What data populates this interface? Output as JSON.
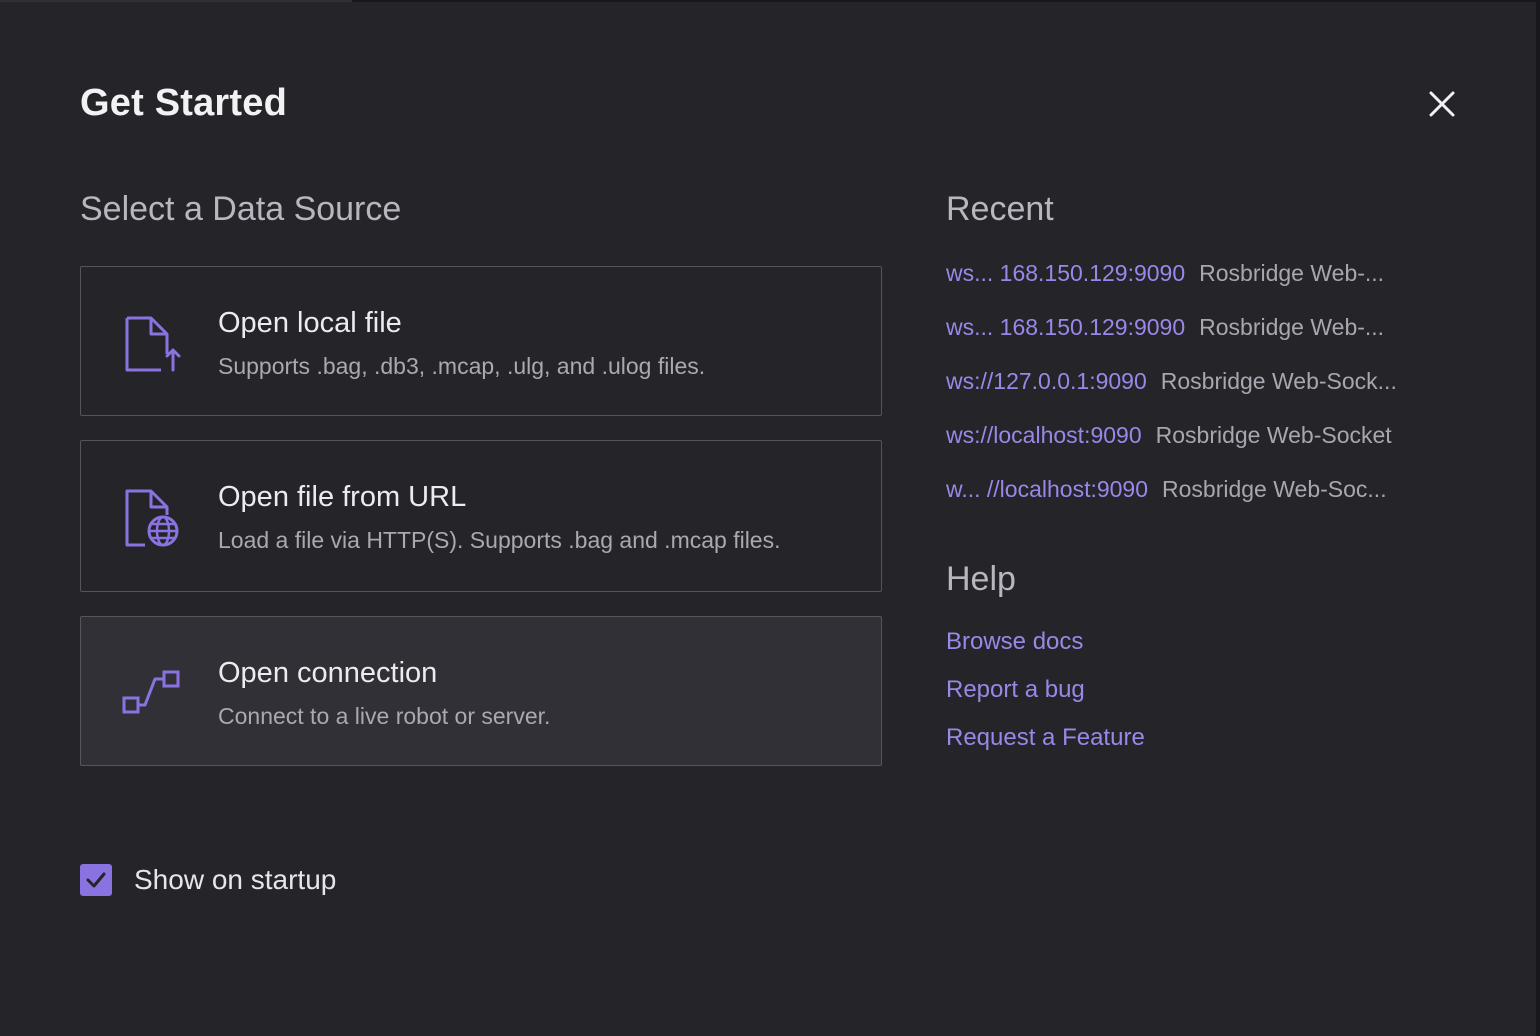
{
  "dialog": {
    "title": "Get Started",
    "close_icon": "close-icon"
  },
  "data_source": {
    "heading": "Select a Data Source",
    "options": [
      {
        "title": "Open local file",
        "description": "Supports .bag, .db3, .mcap, .ulg, and .ulog files.",
        "icon": "file-upload-icon"
      },
      {
        "title": "Open file from URL",
        "description": "Load a file via HTTP(S). Supports .bag and .mcap files.",
        "icon": "file-globe-icon"
      },
      {
        "title": "Open connection",
        "description": "Connect to a live robot or server.",
        "icon": "connection-icon"
      }
    ]
  },
  "recent": {
    "heading": "Recent",
    "items": [
      {
        "url": "ws... 168.150.129:9090",
        "type": "Rosbridge Web-..."
      },
      {
        "url": "ws... 168.150.129:9090",
        "type": "Rosbridge Web-..."
      },
      {
        "url": "ws://127.0.0.1:9090",
        "type": "Rosbridge Web-Sock..."
      },
      {
        "url": "ws://localhost:9090",
        "type": "Rosbridge Web-Socket"
      },
      {
        "url": "w... //localhost:9090",
        "type": "Rosbridge Web-Soc..."
      }
    ]
  },
  "help": {
    "heading": "Help",
    "links": [
      "Browse docs",
      "Report a bug",
      "Request a Feature"
    ]
  },
  "startup": {
    "label": "Show on startup",
    "checked": true
  },
  "colors": {
    "accent": "#9b87e8",
    "checkbox": "#8a73e0",
    "background": "#242429",
    "card_border": "#55555e"
  }
}
